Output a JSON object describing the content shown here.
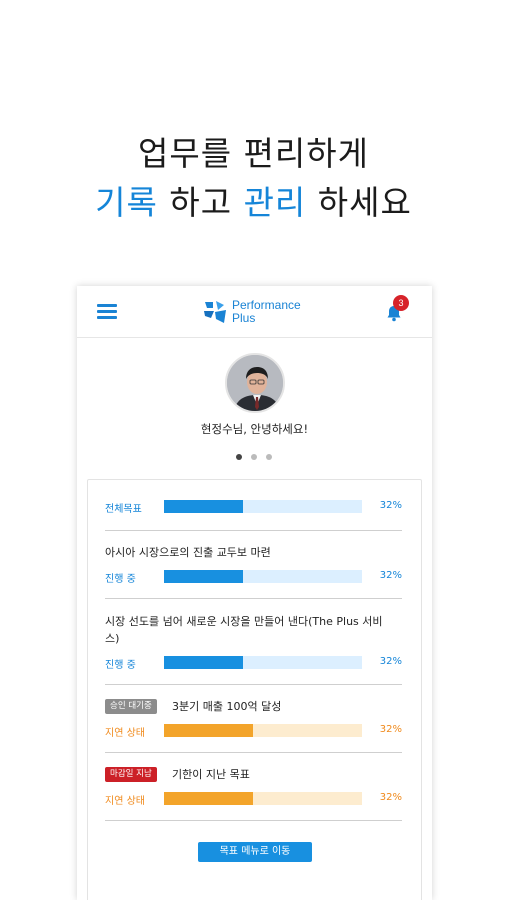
{
  "headline": {
    "line1": "업무를 편리하게",
    "line2": {
      "accent1": "기록",
      "text1": " 하고 ",
      "accent2": "관리",
      "text2": " 하세요"
    },
    "accent_color": "#1585d8"
  },
  "app": {
    "logo": {
      "line1": "Performance",
      "line2": "Plus"
    },
    "notifications_count": "3",
    "greeting": "현정수님, 안녕하세요!",
    "carousel": {
      "pages": 3,
      "active": 1
    }
  },
  "goals": {
    "overall": {
      "label": "전체목표",
      "percent_text": "32%",
      "progress": 0.4
    },
    "items": [
      {
        "title": "아시아 시장으로의 진출 교두보 마련",
        "status": "진행 중",
        "percent_text": "32%",
        "progress": 0.4
      },
      {
        "title": "시장 선도를 넘어 새로운 시장을 만들어 낸다(The Plus 서비스)",
        "status": "진행 중",
        "percent_text": "32%",
        "progress": 0.4
      },
      {
        "badge": "승인 대기중",
        "title": "3분기 매출 100억 달성",
        "status": "지연 상태",
        "percent_text": "32%",
        "progress": 0.45
      },
      {
        "badge": "마감일 지남",
        "title": "기한이 지난 목표",
        "status": "지연 상태",
        "percent_text": "32%",
        "progress": 0.45
      }
    ],
    "button_label": "목표 메뉴로 이동"
  },
  "colors": {
    "primary": "#1890e0",
    "warning": "#f3a42a",
    "danger": "#cc2027",
    "badge_gray": "#8c8c8c"
  },
  "icons": [
    "hamburger-menu-icon",
    "performance-plus-logo-icon",
    "bell-icon"
  ]
}
